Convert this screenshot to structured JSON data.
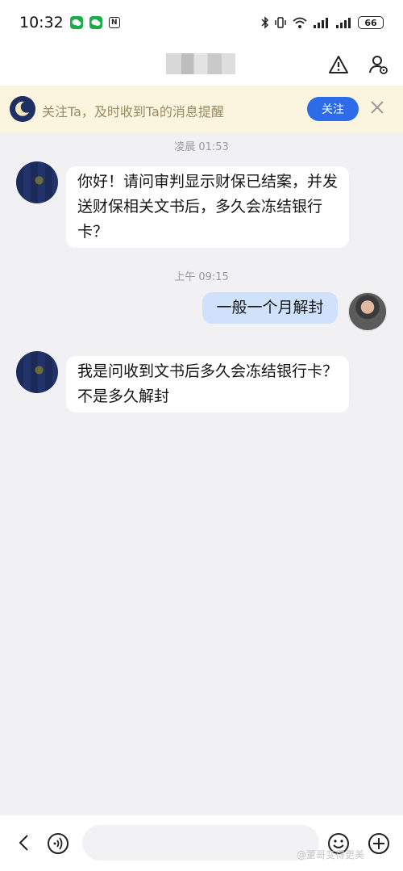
{
  "status_bar": {
    "time": "10:32",
    "battery": "66"
  },
  "header": {
    "title": "***",
    "icons": [
      "warning-icon",
      "user-settings-icon"
    ]
  },
  "follow_banner": {
    "text": "关注Ta，及时收到Ta的消息提醒",
    "button_label": "关注"
  },
  "messages": [
    {
      "timestamp": "凌晨 01:53"
    },
    {
      "sender": "other",
      "text": "你好！请问审判显示财保已结案，并发送财保相关文书后，多久会冻结银行卡？"
    },
    {
      "timestamp": "上午 09:15"
    },
    {
      "sender": "self",
      "text": "一般一个月解封"
    },
    {
      "sender": "other",
      "text": "我是问收到文书后多久会冻结银行卡？不是多久解封"
    }
  ],
  "bottom_bar": {
    "input_placeholder": "",
    "watermark": "@董哥变得更美"
  },
  "colors": {
    "accent": "#2d6ce8",
    "banner_bg": "#fbf4de",
    "self_bubble": "#cfe1fb",
    "background": "#f1f1f3"
  }
}
